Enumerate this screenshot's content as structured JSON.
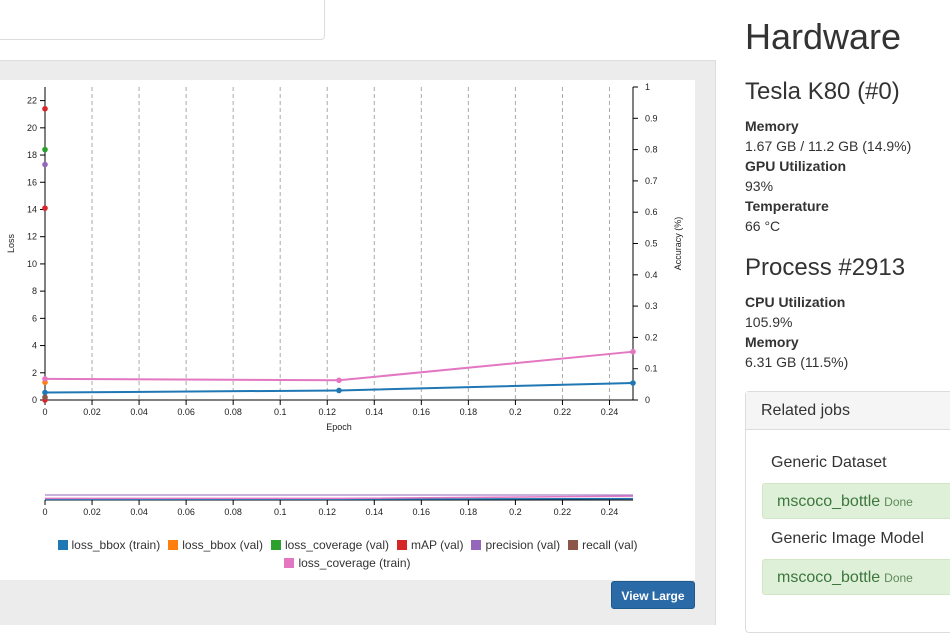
{
  "hardware": {
    "title": "Hardware",
    "gpu_name": "Tesla K80 (#0)",
    "memory_label": "Memory",
    "memory_value": "1.67 GB / 11.2 GB (14.9%)",
    "gpu_util_label": "GPU Utilization",
    "gpu_util_value": "93%",
    "temp_label": "Temperature",
    "temp_value": "66 °C",
    "process_title": "Process #2913",
    "cpu_util_label": "CPU Utilization",
    "cpu_util_value": "105.9%",
    "proc_memory_label": "Memory",
    "proc_memory_value": "6.31 GB (11.5%)"
  },
  "related": {
    "title": "Related jobs",
    "dataset_group": "Generic Dataset",
    "dataset_job": "mscoco_bottle",
    "dataset_status": "Done",
    "model_group": "Generic Image Model",
    "model_job": "mscoco_bottle",
    "model_status": "Done"
  },
  "buttons": {
    "view_large": "View Large"
  },
  "chart_data": {
    "type": "line",
    "xlabel": "Epoch",
    "ylabel": "Loss",
    "y2label": "Accuracy (%)",
    "xlim": [
      0,
      0.25
    ],
    "ylim": [
      0,
      23
    ],
    "y2lim": [
      0,
      1
    ],
    "x_ticks": [
      0,
      0.02,
      0.04,
      0.06,
      0.08,
      0.1,
      0.12,
      0.14,
      0.16,
      0.18,
      0.2,
      0.22,
      0.24
    ],
    "y_ticks": [
      0,
      2,
      4,
      6,
      8,
      10,
      12,
      14,
      16,
      18,
      20,
      22
    ],
    "y2_ticks": [
      0,
      0.1,
      0.2,
      0.3,
      0.4,
      0.5,
      0.6,
      0.7,
      0.8,
      0.9,
      1
    ],
    "grid": "vertical dashed",
    "series": [
      {
        "name": "loss_bbox (train)",
        "color": "#1f77b4",
        "axis": "y",
        "x": [
          0,
          0.125,
          0.25
        ],
        "y": [
          0.55,
          0.7,
          1.25
        ]
      },
      {
        "name": "loss_bbox (val)",
        "color": "#ff7f0e",
        "axis": "y",
        "x": [
          0
        ],
        "y": [
          1.3
        ]
      },
      {
        "name": "loss_coverage (val)",
        "color": "#2ca02c",
        "axis": "y",
        "x": [
          0
        ],
        "y": [
          18.4
        ]
      },
      {
        "name": "mAP (val)",
        "color": "#d62728",
        "axis": "y2",
        "x": [
          0
        ],
        "y": [
          0.0
        ]
      },
      {
        "name": "precision (val)",
        "color": "#9467bd",
        "axis": "y",
        "x": [
          0
        ],
        "y": [
          17.3
        ]
      },
      {
        "name": "recall (val)",
        "color": "#8c564b",
        "axis": "y",
        "x": [
          0
        ],
        "y": [
          0.2
        ]
      },
      {
        "name": "loss_coverage (train)",
        "color": "#e377c2",
        "axis": "y",
        "x": [
          0,
          0.125,
          0.25
        ],
        "y": [
          1.55,
          1.45,
          3.55
        ]
      }
    ],
    "extra_points": [
      {
        "color": "#d62728",
        "x": 0,
        "y": 21.4
      },
      {
        "color": "#d62728",
        "x": 0,
        "y": 14.1
      }
    ]
  }
}
